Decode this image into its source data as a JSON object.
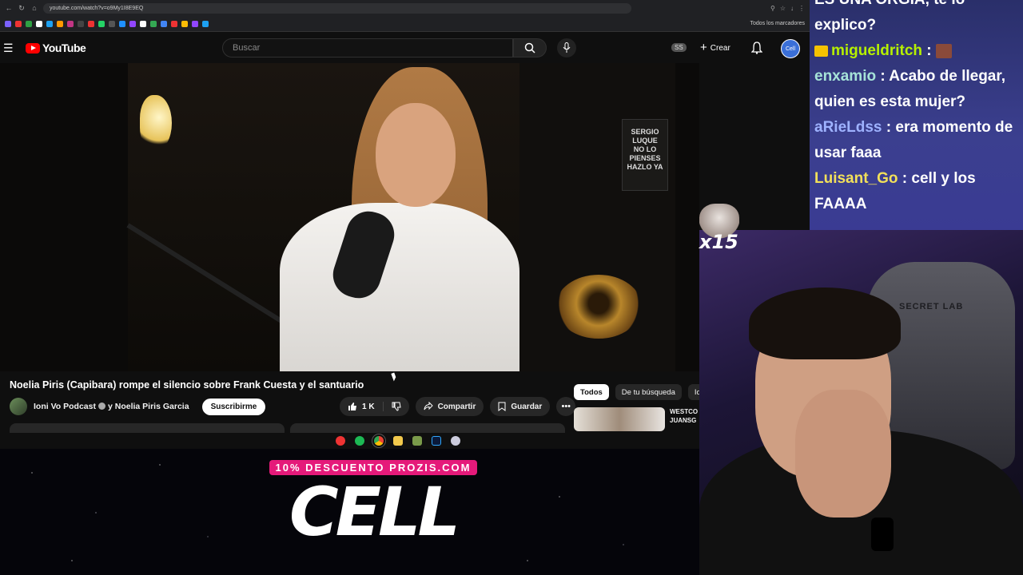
{
  "browser": {
    "url": "youtube.com/watch?v=o9My1I8E9EQ",
    "bookmarks_folder": "Todos los marcadores"
  },
  "youtube": {
    "logo_text": "YouTube",
    "search_placeholder": "Buscar",
    "ss_badge": "SS",
    "create_label": "Crear",
    "avatar_text": "Cell"
  },
  "video": {
    "title": "Noelia Piris (Capibara) rompe el silencio sobre Frank Cuesta y el santuario",
    "channel_primary": "Ioni Vo Podcast",
    "channel_joiner": "y",
    "channel_secondary": "Noelia Piris Garcia",
    "subscribe_label": "Suscribirme",
    "likes": "1 K",
    "share_label": "Compartir",
    "save_label": "Guardar",
    "book_text": "SERGIO LUQUE\nNO LO PIENSES HAZLO YA"
  },
  "sidebar": {
    "chips": [
      "Todos",
      "De tu búsqueda",
      "Ioni"
    ],
    "rec_title": "WESTCO JUANSG"
  },
  "overlay": {
    "sponsor_tag": "10% DESCUENTO PROZIS.COM",
    "sponsor_brand": "CELL",
    "combo_count": "x15"
  },
  "chat": {
    "messages": [
      {
        "user": "",
        "text": "ES UNA ORGIA, te lo explico?",
        "color": "#ffffff"
      },
      {
        "user": "migueldritch",
        "text": ":",
        "color": "#b6f000"
      },
      {
        "user": "enxamio",
        "text": ": Acabo de llegar, quien es esta mujer?",
        "color": "#a6e3d8"
      },
      {
        "user": "aRieLdss",
        "text": ": era momento de usar faaa",
        "color": "#9eb2ff"
      },
      {
        "user": "Luisant_Go",
        "text": ": cell y los FAAAA",
        "color": "#f2e05a"
      }
    ]
  },
  "webcam": {
    "chair_logo": "SECRET LAB"
  }
}
